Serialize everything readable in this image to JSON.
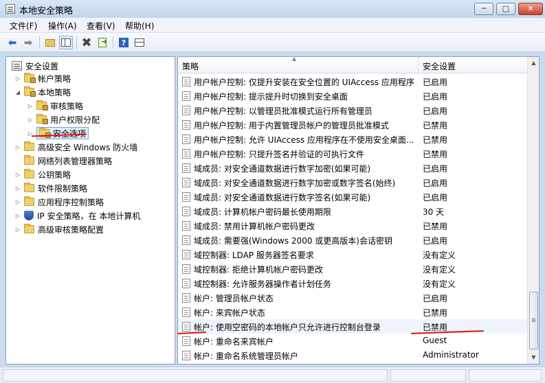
{
  "window": {
    "title": "本地安全策略",
    "minimize_glyph": "─",
    "maximize_glyph": "□",
    "close_glyph": "✕"
  },
  "menu": {
    "items": [
      "文件(F)",
      "操作(A)",
      "查看(V)",
      "帮助(H)"
    ]
  },
  "toolbar": {
    "icons": [
      "back-arrow-icon",
      "forward-arrow-icon",
      "up-folder-icon",
      "show-hide-tree-icon",
      "delete-icon",
      "export-list-icon",
      "help-icon",
      "properties-pane-icon"
    ]
  },
  "tree": {
    "items": [
      {
        "label": "安全设置",
        "icon": "root-icon",
        "expander": ""
      },
      {
        "label": "帐户策略",
        "icon": "folder-icon",
        "expander": "▷"
      },
      {
        "label": "本地策略",
        "icon": "folder-icon",
        "expander": "◢"
      },
      {
        "label": "审核策略",
        "icon": "folder-icon",
        "expander": "▷"
      },
      {
        "label": "用户权限分配",
        "icon": "folder-icon",
        "expander": "▷"
      },
      {
        "label": "安全选项",
        "icon": "folder-icon",
        "expander": "▷"
      },
      {
        "label": "高级安全 Windows 防火墙",
        "icon": "folder-icon",
        "expander": "▷"
      },
      {
        "label": "网络列表管理器策略",
        "icon": "folder-icon",
        "expander": ""
      },
      {
        "label": "公钥策略",
        "icon": "folder-icon",
        "expander": "▷"
      },
      {
        "label": "软件限制策略",
        "icon": "folder-icon",
        "expander": "▷"
      },
      {
        "label": "应用程序控制策略",
        "icon": "folder-icon",
        "expander": "▷"
      },
      {
        "label": "IP 安全策略，在 本地计算机",
        "icon": "shield-icon",
        "expander": "▷"
      },
      {
        "label": "高级审核策略配置",
        "icon": "folder-icon",
        "expander": "▷"
      }
    ]
  },
  "list": {
    "headers": {
      "policy": "策略",
      "setting": "安全设置"
    },
    "rows": [
      {
        "policy": "用户帐户控制: 仅提升安装在安全位置的 UIAccess 应用程序",
        "setting": "已启用"
      },
      {
        "policy": "用户帐户控制: 提示提升时切换到安全桌面",
        "setting": "已启用"
      },
      {
        "policy": "用户帐户控制: 以管理员批准模式运行所有管理员",
        "setting": "已启用"
      },
      {
        "policy": "用户帐户控制: 用于内置管理员帐户的管理员批准模式",
        "setting": "已禁用"
      },
      {
        "policy": "用户帐户控制: 允许 UIAccess 应用程序在不使用安全桌面...",
        "setting": "已禁用"
      },
      {
        "policy": "用户帐户控制: 只提升签名并验证的可执行文件",
        "setting": "已禁用"
      },
      {
        "policy": "域成员: 对安全通道数据进行数字加密(如果可能)",
        "setting": "已启用"
      },
      {
        "policy": "域成员: 对安全通道数据进行数字加密或数字签名(始终)",
        "setting": "已启用"
      },
      {
        "policy": "域成员: 对安全通道数据进行数字签名(如果可能)",
        "setting": "已启用"
      },
      {
        "policy": "域成员: 计算机帐户密码最长使用期限",
        "setting": "30 天"
      },
      {
        "policy": "域成员: 禁用计算机帐户密码更改",
        "setting": "已禁用"
      },
      {
        "policy": "域成员: 需要强(Windows 2000 或更高版本)会话密钥",
        "setting": "已启用"
      },
      {
        "policy": "域控制器: LDAP 服务器签名要求",
        "setting": "没有定义"
      },
      {
        "policy": "域控制器: 拒绝计算机帐户密码更改",
        "setting": "没有定义"
      },
      {
        "policy": "域控制器: 允许服务器操作者计划任务",
        "setting": "没有定义"
      },
      {
        "policy": "帐户: 管理员帐户状态",
        "setting": "已启用"
      },
      {
        "policy": "帐户: 来宾帐户状态",
        "setting": "已禁用"
      },
      {
        "policy": "帐户: 使用空密码的本地帐户只允许进行控制台登录",
        "setting": "已禁用"
      },
      {
        "policy": "帐户: 重命名来宾帐户",
        "setting": "Guest"
      },
      {
        "policy": "帐户: 重命名系统管理员帐户",
        "setting": "Administrator"
      }
    ]
  },
  "scroll": {
    "up_glyph": "▲",
    "down_glyph": "▼"
  },
  "colors": {
    "annotation": "#e01010",
    "selection": "#dcebfc"
  }
}
